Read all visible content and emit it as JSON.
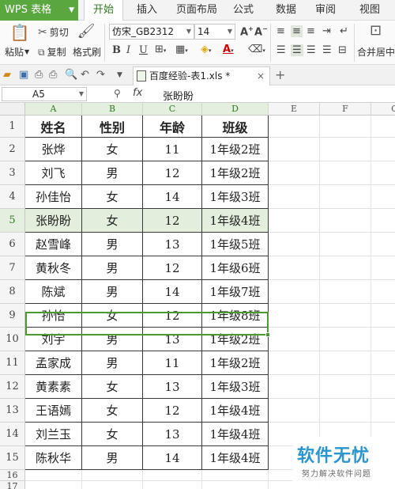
{
  "app": {
    "wps_button": "WPS 表格"
  },
  "menu_tabs": [
    "开始",
    "插入",
    "页面布局",
    "公式",
    "数据",
    "审阅",
    "视图"
  ],
  "ribbon": {
    "paste": "粘贴",
    "cut": "剪切",
    "copy": "复制",
    "format_painter": "格式刷",
    "font_name": "仿宋_GB2312",
    "font_size": "14",
    "merge_center": "合并居中"
  },
  "document": {
    "tab_title": "百度经验-表1.xls *"
  },
  "formula_bar": {
    "cell_ref": "A5",
    "value": "张盼盼"
  },
  "columns": [
    "A",
    "B",
    "C",
    "D",
    "E",
    "F",
    "G"
  ],
  "rows": [
    "1",
    "2",
    "3",
    "4",
    "5",
    "6",
    "7",
    "8",
    "9",
    "10",
    "11",
    "12",
    "13",
    "14",
    "15",
    "16",
    "17"
  ],
  "table": {
    "headers": [
      "姓名",
      "性别",
      "年龄",
      "班级"
    ],
    "rows": [
      [
        "张烨",
        "女",
        "11",
        "1年级2班"
      ],
      [
        "刘飞",
        "男",
        "12",
        "1年级2班"
      ],
      [
        "孙佳怡",
        "女",
        "14",
        "1年级3班"
      ],
      [
        "张盼盼",
        "女",
        "12",
        "1年级4班"
      ],
      [
        "赵雪峰",
        "男",
        "13",
        "1年级5班"
      ],
      [
        "黄秋冬",
        "男",
        "12",
        "1年级6班"
      ],
      [
        "陈斌",
        "男",
        "14",
        "1年级7班"
      ],
      [
        "孙怡",
        "女",
        "12",
        "1年级8班"
      ],
      [
        "刘宇",
        "男",
        "13",
        "1年级2班"
      ],
      [
        "孟家成",
        "男",
        "11",
        "1年级2班"
      ],
      [
        "黄素素",
        "女",
        "13",
        "1年级3班"
      ],
      [
        "王语嫣",
        "女",
        "12",
        "1年级4班"
      ],
      [
        "刘兰玉",
        "女",
        "13",
        "1年级4班"
      ],
      [
        "陈秋华",
        "男",
        "14",
        "1年级4班"
      ]
    ]
  },
  "watermark": {
    "logo": "软件无忧",
    "subtitle": "努力解决软件问题"
  },
  "colors": {
    "accent": "#5aa63f",
    "selection": "#4a9a2e",
    "watermark": "#2b95ce"
  }
}
